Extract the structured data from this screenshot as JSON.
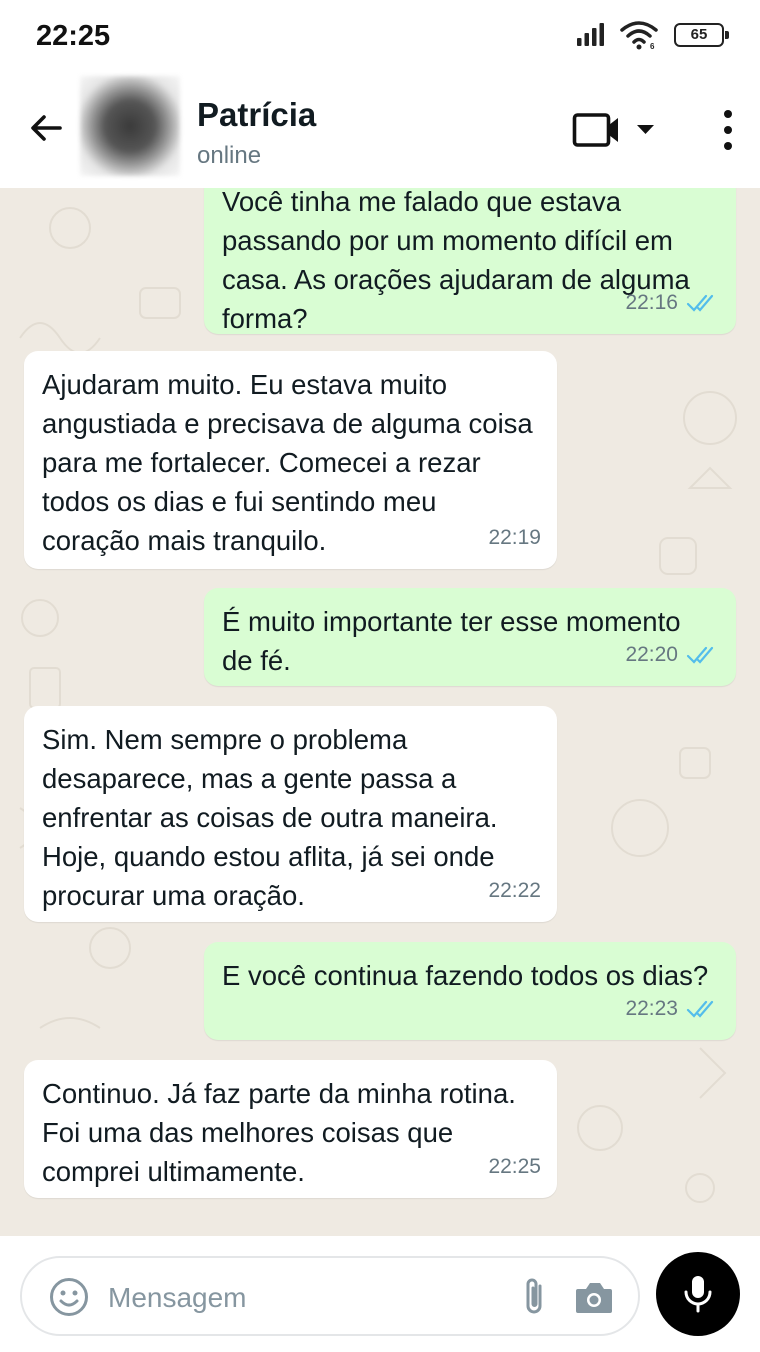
{
  "status_bar": {
    "time": "22:25",
    "battery": "65"
  },
  "header": {
    "contact_name": "Patrícia",
    "contact_status": "online"
  },
  "messages": [
    {
      "direction": "out",
      "text": "Você tinha me falado que estava passando por um momento difícil em casa. As orações ajudaram de alguma forma?",
      "time": "22:16",
      "read": true
    },
    {
      "direction": "in",
      "text": "Ajudaram muito. Eu estava muito angustiada e precisava de alguma coisa para me fortalecer. Comecei a rezar todos os dias e fui sentindo meu coração mais tranquilo.",
      "time": "22:19"
    },
    {
      "direction": "out",
      "text": "É muito importante ter esse momento de fé.",
      "time": "22:20",
      "read": true
    },
    {
      "direction": "in",
      "text": "Sim. Nem sempre o problema desaparece, mas a gente passa a enfrentar as coisas de outra maneira. Hoje, quando estou aflita, já sei onde procurar uma oração.",
      "time": "22:22"
    },
    {
      "direction": "out",
      "text": "E você continua fazendo todos os dias?",
      "time": "22:23",
      "read": true
    },
    {
      "direction": "in",
      "text": "Continuo. Já faz parte da minha rotina. Foi uma das melhores coisas que comprei ultimamente.",
      "time": "22:25"
    }
  ],
  "composer": {
    "placeholder": "Mensagem",
    "value": ""
  },
  "colors": {
    "outgoing_bubble": "#d9fdd3",
    "incoming_bubble": "#ffffff",
    "chat_background": "#efeae2",
    "read_ticks": "#53bdeb",
    "mic_button": "#000000"
  },
  "icons": {
    "back": "arrow-left-icon",
    "video": "video-camera-icon",
    "dropdown": "caret-down-icon",
    "menu": "more-vertical-icon",
    "emoji": "smiley-icon",
    "attach": "paperclip-icon",
    "camera": "camera-icon",
    "mic": "microphone-icon",
    "read": "double-check-icon"
  }
}
